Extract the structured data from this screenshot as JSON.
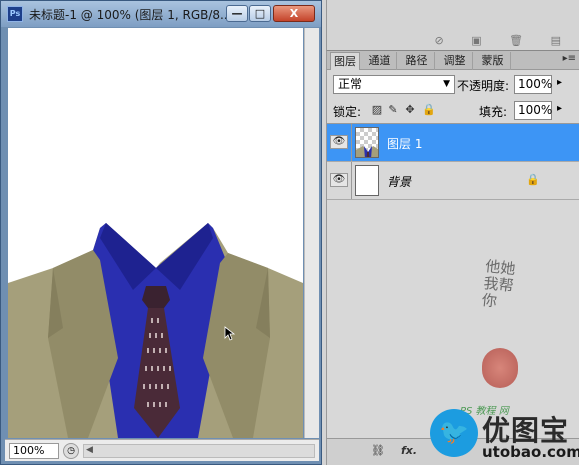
{
  "document": {
    "app_icon": "Ps",
    "title": "未标题-1 @ 100% (图层 1, RGB/8...",
    "zoom": "100%",
    "window_buttons": {
      "minimize": "—",
      "maximize": "□",
      "close": "X"
    }
  },
  "layers_panel": {
    "tabs": [
      {
        "label": "图层",
        "active": true
      },
      {
        "label": "通道",
        "active": false
      },
      {
        "label": "路径",
        "active": false
      },
      {
        "label": "调整",
        "active": false
      },
      {
        "label": "蒙版",
        "active": false
      }
    ],
    "menu_icon": "▸≡",
    "blend_mode": "正常",
    "opacity_label": "不透明度:",
    "opacity_value": "100%",
    "lock_label": "锁定:",
    "fill_label": "填充:",
    "fill_value": "100%",
    "layers": [
      {
        "name": "图层 1",
        "selected": true,
        "visible": true
      },
      {
        "name": "背景",
        "selected": false,
        "visible": true,
        "locked": true
      }
    ],
    "bottom_icons": [
      "link-icon",
      "fx-icon"
    ],
    "fx_label": "fx."
  },
  "watermark": {
    "calligraphy": "他她我帮你",
    "small_text": "PS 教程 网",
    "brand": "优图宝",
    "domain": "utobao.com"
  },
  "colors": {
    "selection": "#3d95f5",
    "suit": "#a59f7b",
    "shirt": "#2a2fb0",
    "titlebar": "#7e9ec3"
  }
}
